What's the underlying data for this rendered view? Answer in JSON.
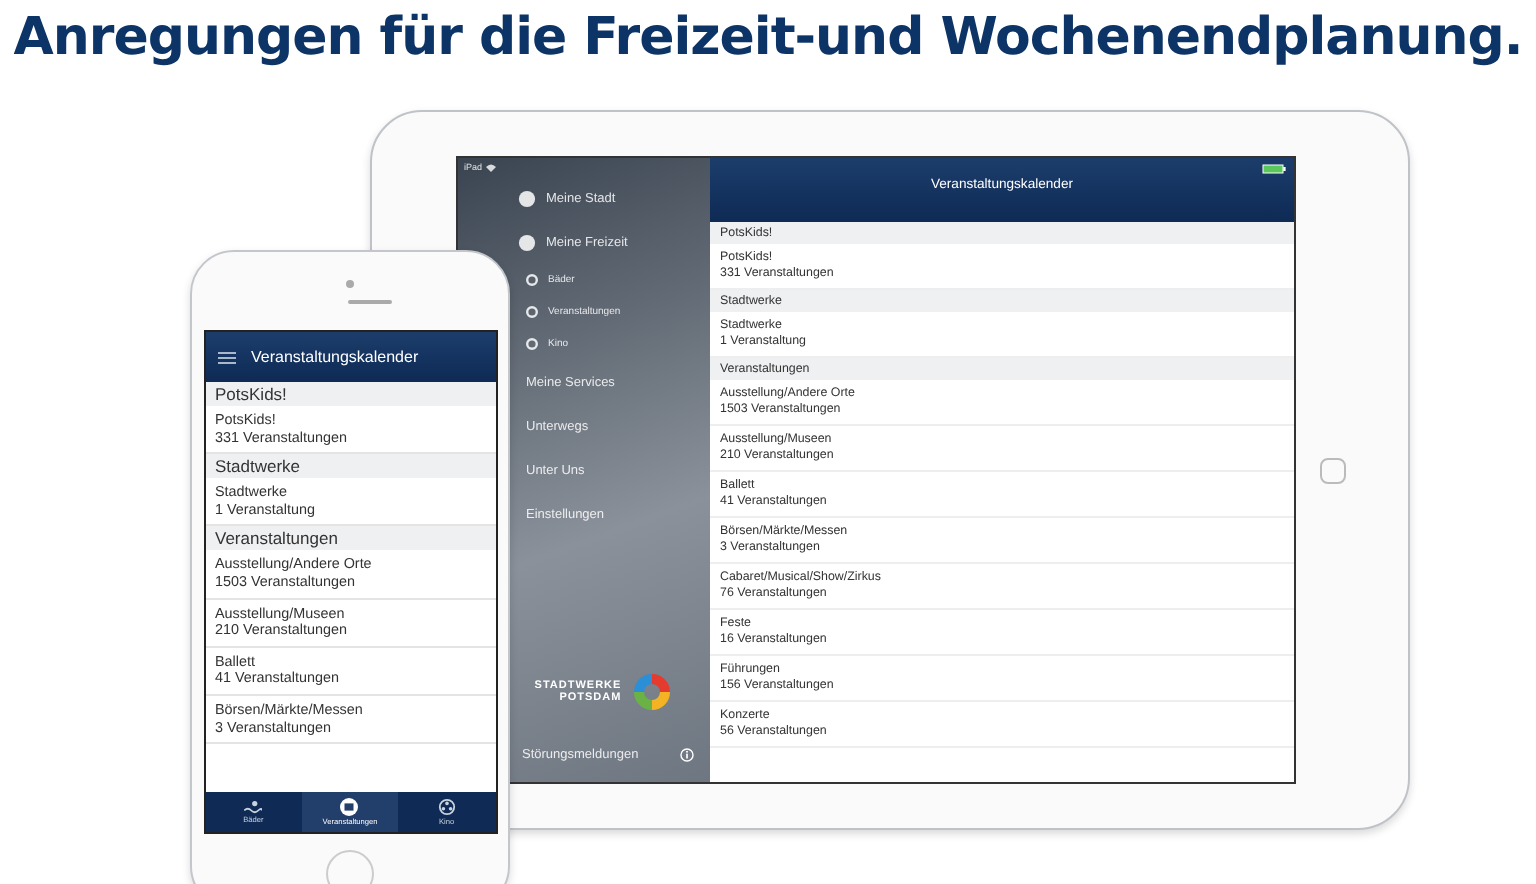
{
  "headline": "Anregungen für die Freizeit-und Wochenendplanung.",
  "tablet": {
    "status": {
      "device": "iPad"
    },
    "sidebar": {
      "items": [
        {
          "label": "Meine Stadt",
          "kind": "section"
        },
        {
          "label": "Meine Freizeit",
          "kind": "section"
        },
        {
          "label": "Bäder",
          "kind": "sub"
        },
        {
          "label": "Veranstaltungen",
          "kind": "sub"
        },
        {
          "label": "Kino",
          "kind": "sub"
        },
        {
          "label": "Meine Services",
          "kind": "link"
        },
        {
          "label": "Unterwegs",
          "kind": "link"
        },
        {
          "label": "Unter Uns",
          "kind": "link"
        },
        {
          "label": "Einstellungen",
          "kind": "link"
        }
      ],
      "logo": {
        "line1": "STADTWERKE",
        "line2": "POTSDAM"
      },
      "footer": "Störungsmeldungen"
    },
    "calendar": {
      "title": "Veranstaltungskalender",
      "sections": [
        {
          "title": "PotsKids!",
          "entries": [
            {
              "name": "PotsKids!",
              "count": "331 Veranstaltungen"
            }
          ]
        },
        {
          "title": "Stadtwerke",
          "entries": [
            {
              "name": "Stadtwerke",
              "count": "1 Veranstaltung"
            }
          ]
        },
        {
          "title": "Veranstaltungen",
          "entries": [
            {
              "name": "Ausstellung/Andere Orte",
              "count": "1503 Veranstaltungen"
            },
            {
              "name": "Ausstellung/Museen",
              "count": "210 Veranstaltungen"
            },
            {
              "name": "Ballett",
              "count": "41 Veranstaltungen"
            },
            {
              "name": "Börsen/Märkte/Messen",
              "count": "3 Veranstaltungen"
            },
            {
              "name": "Cabaret/Musical/Show/Zirkus",
              "count": "76 Veranstaltungen"
            },
            {
              "name": "Feste",
              "count": "16 Veranstaltungen"
            },
            {
              "name": "Führungen",
              "count": "156 Veranstaltungen"
            },
            {
              "name": "Konzerte",
              "count": "56 Veranstaltungen"
            }
          ]
        }
      ]
    }
  },
  "phone": {
    "title": "Veranstaltungskalender",
    "sections": [
      {
        "title": "PotsKids!",
        "entries": [
          {
            "name": "PotsKids!",
            "count": "331 Veranstaltungen"
          }
        ]
      },
      {
        "title": "Stadtwerke",
        "entries": [
          {
            "name": "Stadtwerke",
            "count": "1 Veranstaltung"
          }
        ]
      },
      {
        "title": "Veranstaltungen",
        "entries": [
          {
            "name": "Ausstellung/Andere Orte",
            "count": "1503 Veranstaltungen"
          },
          {
            "name": "Ausstellung/Museen",
            "count": "210 Veranstaltungen"
          },
          {
            "name": "Ballett",
            "count": "41 Veranstaltungen"
          },
          {
            "name": "Börsen/Märkte/Messen",
            "count": "3 Veranstaltungen"
          }
        ]
      }
    ],
    "tabs": [
      {
        "label": "Bäder",
        "selected": false
      },
      {
        "label": "Veranstaltungen",
        "selected": true
      },
      {
        "label": "Kino",
        "selected": false
      }
    ]
  }
}
